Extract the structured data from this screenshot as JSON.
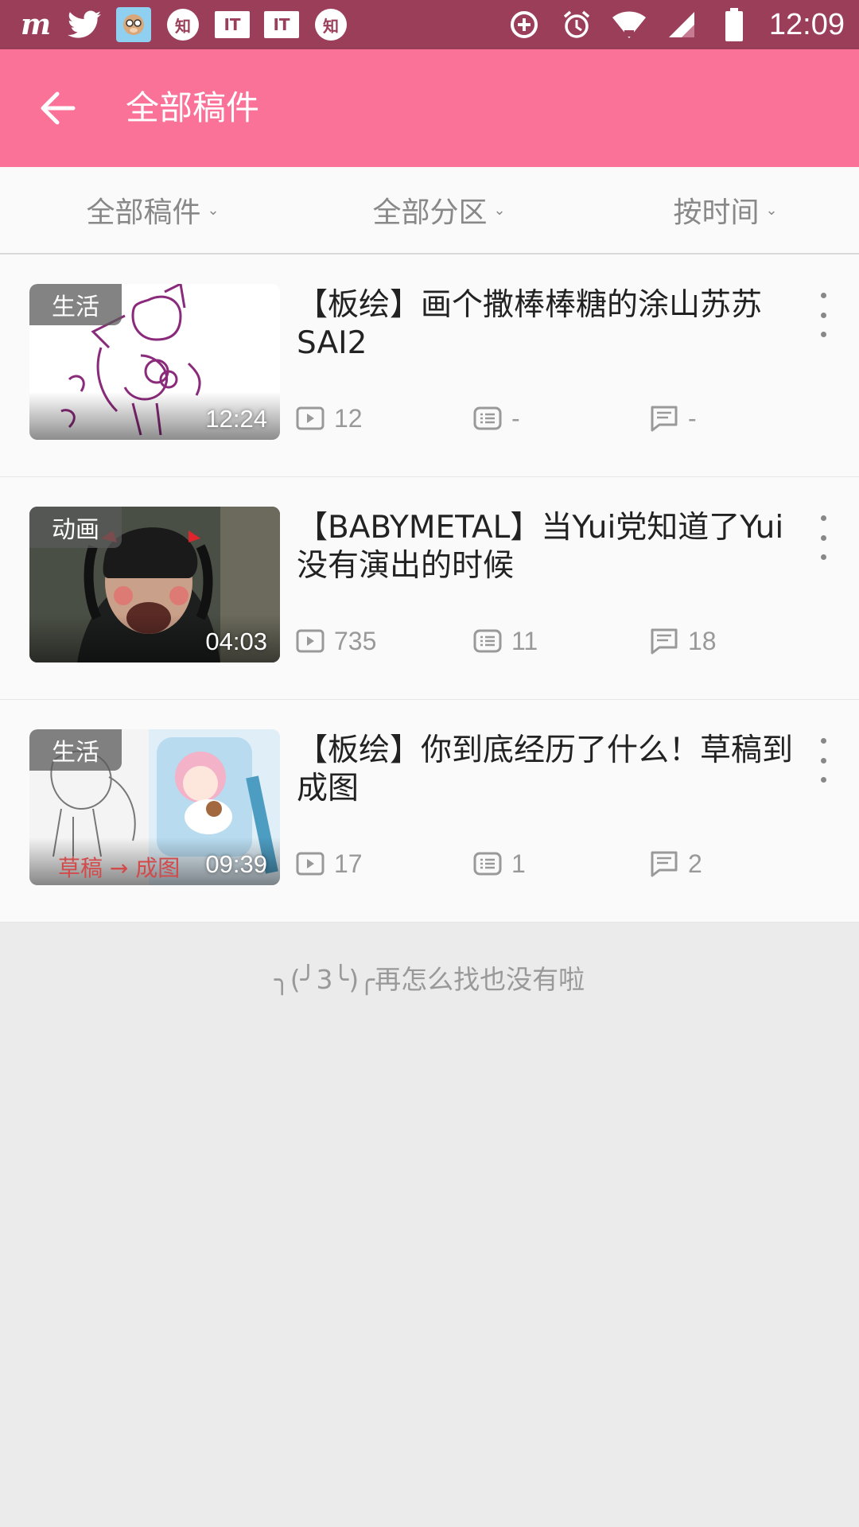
{
  "status_bar": {
    "time": "12:09",
    "left_icons": [
      "m-app-icon",
      "twitter-icon",
      "monkey-avatar-icon",
      "zhihu-icon",
      "ithome-icon",
      "ithome-icon",
      "zhihu-icon"
    ],
    "zhihu_label": "知",
    "it_label": "IT",
    "right_icons": [
      "data-saver-icon",
      "alarm-icon",
      "wifi-icon",
      "signal-icon",
      "battery-icon"
    ]
  },
  "app_bar": {
    "title": "全部稿件",
    "background": "#fb7299"
  },
  "filters": [
    {
      "label": "全部稿件"
    },
    {
      "label": "全部分区"
    },
    {
      "label": "按时间"
    }
  ],
  "videos": [
    {
      "tag": "生活",
      "duration": "12:24",
      "title": "【板绘】画个撒棒棒糖的涂山苏苏SAI2",
      "plays": "12",
      "danmaku": "-",
      "comments": "-"
    },
    {
      "tag": "动画",
      "duration": "04:03",
      "title": "【BABYMETAL】当Yui党知道了Yui没有演出的时候",
      "plays": "735",
      "danmaku": "11",
      "comments": "18"
    },
    {
      "tag": "生活",
      "duration": "09:39",
      "title": "【板绘】你到底经历了什么！草稿到成图",
      "plays": "17",
      "danmaku": "1",
      "comments": "2",
      "thumb_caption": "草稿 → 成图"
    }
  ],
  "footer": {
    "message": "╮(╯3╰)╭再怎么找也没有啦"
  }
}
